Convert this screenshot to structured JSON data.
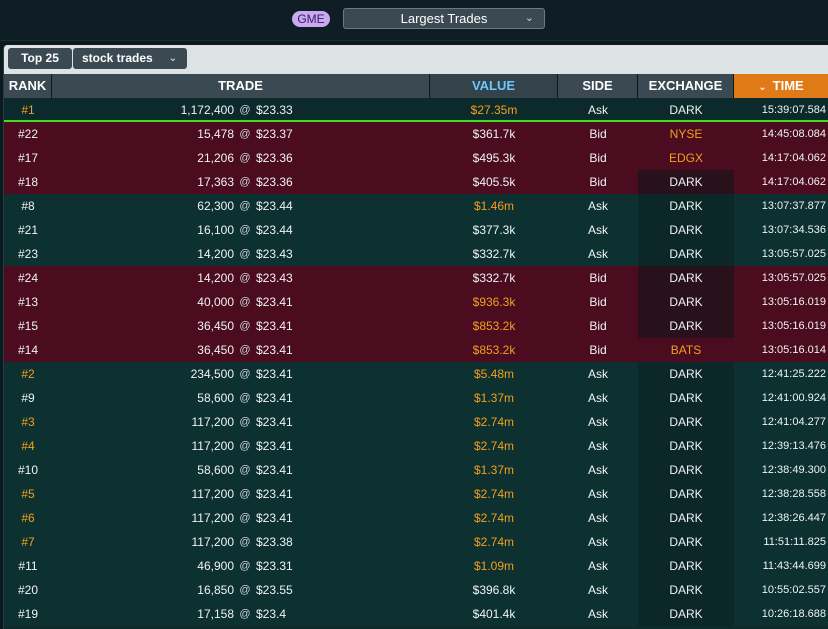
{
  "topbar": {
    "ticker": "GME",
    "view_select": "Largest Trades"
  },
  "toolbar": {
    "top_n": "Top 25",
    "trade_type": "stock trades"
  },
  "columns": {
    "rank": "RANK",
    "trade": "TRADE",
    "value": "VALUE",
    "side": "SIDE",
    "exchange": "EXCHANGE",
    "time": "TIME"
  },
  "colors": {
    "ask_row": "#0d3030",
    "bid_row": "#4a0c1e",
    "highlight_orange": "#f2a01e",
    "time_header": "#e07a17",
    "newest_line": "#3fe01c"
  },
  "rows": [
    {
      "rank": "#1",
      "qty": "1,172,400",
      "price": "$23.33",
      "value": "$27.35m",
      "side": "Ask",
      "exchange": "DARK",
      "time": "15:39:07.584",
      "rank_orange": true,
      "value_orange": true,
      "exch_orange": false
    },
    {
      "rank": "#22",
      "qty": "15,478",
      "price": "$23.37",
      "value": "$361.7k",
      "side": "Bid",
      "exchange": "NYSE",
      "time": "14:45:08.084",
      "rank_orange": false,
      "value_orange": false,
      "exch_orange": true
    },
    {
      "rank": "#17",
      "qty": "21,206",
      "price": "$23.36",
      "value": "$495.3k",
      "side": "Bid",
      "exchange": "EDGX",
      "time": "14:17:04.062",
      "rank_orange": false,
      "value_orange": false,
      "exch_orange": true
    },
    {
      "rank": "#18",
      "qty": "17,363",
      "price": "$23.36",
      "value": "$405.5k",
      "side": "Bid",
      "exchange": "DARK",
      "time": "14:17:04.062",
      "rank_orange": false,
      "value_orange": false,
      "exch_orange": false
    },
    {
      "rank": "#8",
      "qty": "62,300",
      "price": "$23.44",
      "value": "$1.46m",
      "side": "Ask",
      "exchange": "DARK",
      "time": "13:07:37.877",
      "rank_orange": false,
      "value_orange": true,
      "exch_orange": false
    },
    {
      "rank": "#21",
      "qty": "16,100",
      "price": "$23.44",
      "value": "$377.3k",
      "side": "Ask",
      "exchange": "DARK",
      "time": "13:07:34.536",
      "rank_orange": false,
      "value_orange": false,
      "exch_orange": false
    },
    {
      "rank": "#23",
      "qty": "14,200",
      "price": "$23.43",
      "value": "$332.7k",
      "side": "Ask",
      "exchange": "DARK",
      "time": "13:05:57.025",
      "rank_orange": false,
      "value_orange": false,
      "exch_orange": false
    },
    {
      "rank": "#24",
      "qty": "14,200",
      "price": "$23.43",
      "value": "$332.7k",
      "side": "Bid",
      "exchange": "DARK",
      "time": "13:05:57.025",
      "rank_orange": false,
      "value_orange": false,
      "exch_orange": false
    },
    {
      "rank": "#13",
      "qty": "40,000",
      "price": "$23.41",
      "value": "$936.3k",
      "side": "Bid",
      "exchange": "DARK",
      "time": "13:05:16.019",
      "rank_orange": false,
      "value_orange": true,
      "exch_orange": false
    },
    {
      "rank": "#15",
      "qty": "36,450",
      "price": "$23.41",
      "value": "$853.2k",
      "side": "Bid",
      "exchange": "DARK",
      "time": "13:05:16.019",
      "rank_orange": false,
      "value_orange": true,
      "exch_orange": false
    },
    {
      "rank": "#14",
      "qty": "36,450",
      "price": "$23.41",
      "value": "$853.2k",
      "side": "Bid",
      "exchange": "BATS",
      "time": "13:05:16.014",
      "rank_orange": false,
      "value_orange": true,
      "exch_orange": true
    },
    {
      "rank": "#2",
      "qty": "234,500",
      "price": "$23.41",
      "value": "$5.48m",
      "side": "Ask",
      "exchange": "DARK",
      "time": "12:41:25.222",
      "rank_orange": true,
      "value_orange": true,
      "exch_orange": false
    },
    {
      "rank": "#9",
      "qty": "58,600",
      "price": "$23.41",
      "value": "$1.37m",
      "side": "Ask",
      "exchange": "DARK",
      "time": "12:41:00.924",
      "rank_orange": false,
      "value_orange": true,
      "exch_orange": false
    },
    {
      "rank": "#3",
      "qty": "117,200",
      "price": "$23.41",
      "value": "$2.74m",
      "side": "Ask",
      "exchange": "DARK",
      "time": "12:41:04.277",
      "rank_orange": true,
      "value_orange": true,
      "exch_orange": false
    },
    {
      "rank": "#4",
      "qty": "117,200",
      "price": "$23.41",
      "value": "$2.74m",
      "side": "Ask",
      "exchange": "DARK",
      "time": "12:39:13.476",
      "rank_orange": true,
      "value_orange": true,
      "exch_orange": false
    },
    {
      "rank": "#10",
      "qty": "58,600",
      "price": "$23.41",
      "value": "$1.37m",
      "side": "Ask",
      "exchange": "DARK",
      "time": "12:38:49.300",
      "rank_orange": false,
      "value_orange": true,
      "exch_orange": false
    },
    {
      "rank": "#5",
      "qty": "117,200",
      "price": "$23.41",
      "value": "$2.74m",
      "side": "Ask",
      "exchange": "DARK",
      "time": "12:38:28.558",
      "rank_orange": true,
      "value_orange": true,
      "exch_orange": false
    },
    {
      "rank": "#6",
      "qty": "117,200",
      "price": "$23.41",
      "value": "$2.74m",
      "side": "Ask",
      "exchange": "DARK",
      "time": "12:38:26.447",
      "rank_orange": true,
      "value_orange": true,
      "exch_orange": false
    },
    {
      "rank": "#7",
      "qty": "117,200",
      "price": "$23.38",
      "value": "$2.74m",
      "side": "Ask",
      "exchange": "DARK",
      "time": "11:51:11.825",
      "rank_orange": true,
      "value_orange": true,
      "exch_orange": false
    },
    {
      "rank": "#11",
      "qty": "46,900",
      "price": "$23.31",
      "value": "$1.09m",
      "side": "Ask",
      "exchange": "DARK",
      "time": "11:43:44.699",
      "rank_orange": false,
      "value_orange": true,
      "exch_orange": false
    },
    {
      "rank": "#20",
      "qty": "16,850",
      "price": "$23.55",
      "value": "$396.8k",
      "side": "Ask",
      "exchange": "DARK",
      "time": "10:55:02.557",
      "rank_orange": false,
      "value_orange": false,
      "exch_orange": false
    },
    {
      "rank": "#19",
      "qty": "17,158",
      "price": "$23.4",
      "value": "$401.4k",
      "side": "Ask",
      "exchange": "DARK",
      "time": "10:26:18.688",
      "rank_orange": false,
      "value_orange": false,
      "exch_orange": false
    }
  ]
}
